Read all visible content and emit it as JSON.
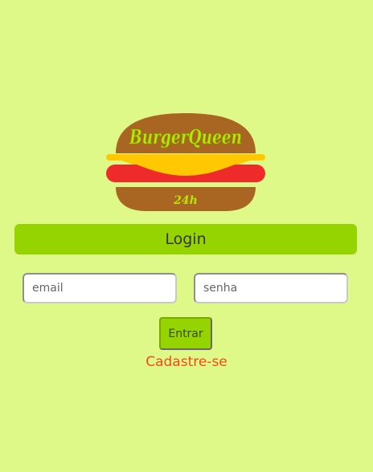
{
  "logo": {
    "brand_name": "BurgerQueen",
    "tagline": "24h"
  },
  "login_banner": {
    "label": "Login"
  },
  "form": {
    "email_placeholder": "email",
    "password_placeholder": "senha",
    "submit_label": "Entrar"
  },
  "links": {
    "signup_label": "Cadastre-se"
  },
  "colors": {
    "background": "#def987",
    "accent_green": "#96d400",
    "link_orange": "#f04a1e",
    "bun_brown": "#a86622",
    "cheese_yellow": "#ffc800",
    "tomato_red": "#ee2a2a"
  }
}
